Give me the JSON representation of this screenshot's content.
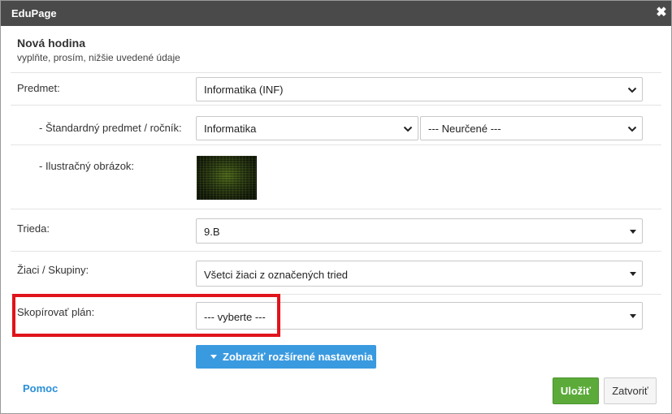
{
  "window": {
    "title": "EduPage",
    "close_glyph": "✖"
  },
  "header": {
    "title": "Nová hodina",
    "subtitle": "vyplňte, prosím, nižšie uvedené údaje"
  },
  "form": {
    "subject": {
      "label": "Predmet:",
      "value": "Informatika (INF)"
    },
    "standard_subject": {
      "label": "- Štandardný predmet / ročník:",
      "subject_value": "Informatika",
      "grade_value": "--- Neurčené ---"
    },
    "image": {
      "label": "- Ilustračný obrázok:"
    },
    "class": {
      "label": "Trieda:",
      "value": "9.B"
    },
    "students": {
      "label": "Žiaci / Skupiny:",
      "value": "Všetci žiaci z označených tried"
    },
    "copy_plan": {
      "label": "Skopírovať plán:",
      "value": "--- vyberte ---"
    }
  },
  "actions": {
    "advanced_label": "Zobraziť rozšírené nastavenia",
    "help_label": "Pomoc",
    "save_label": "Uložiť",
    "close_label": "Zatvoriť"
  },
  "colors": {
    "titlebar": "#4a4a4a",
    "accent_blue": "#3a9ae0",
    "save_green": "#5cab3a",
    "highlight_red": "#e0141b"
  }
}
